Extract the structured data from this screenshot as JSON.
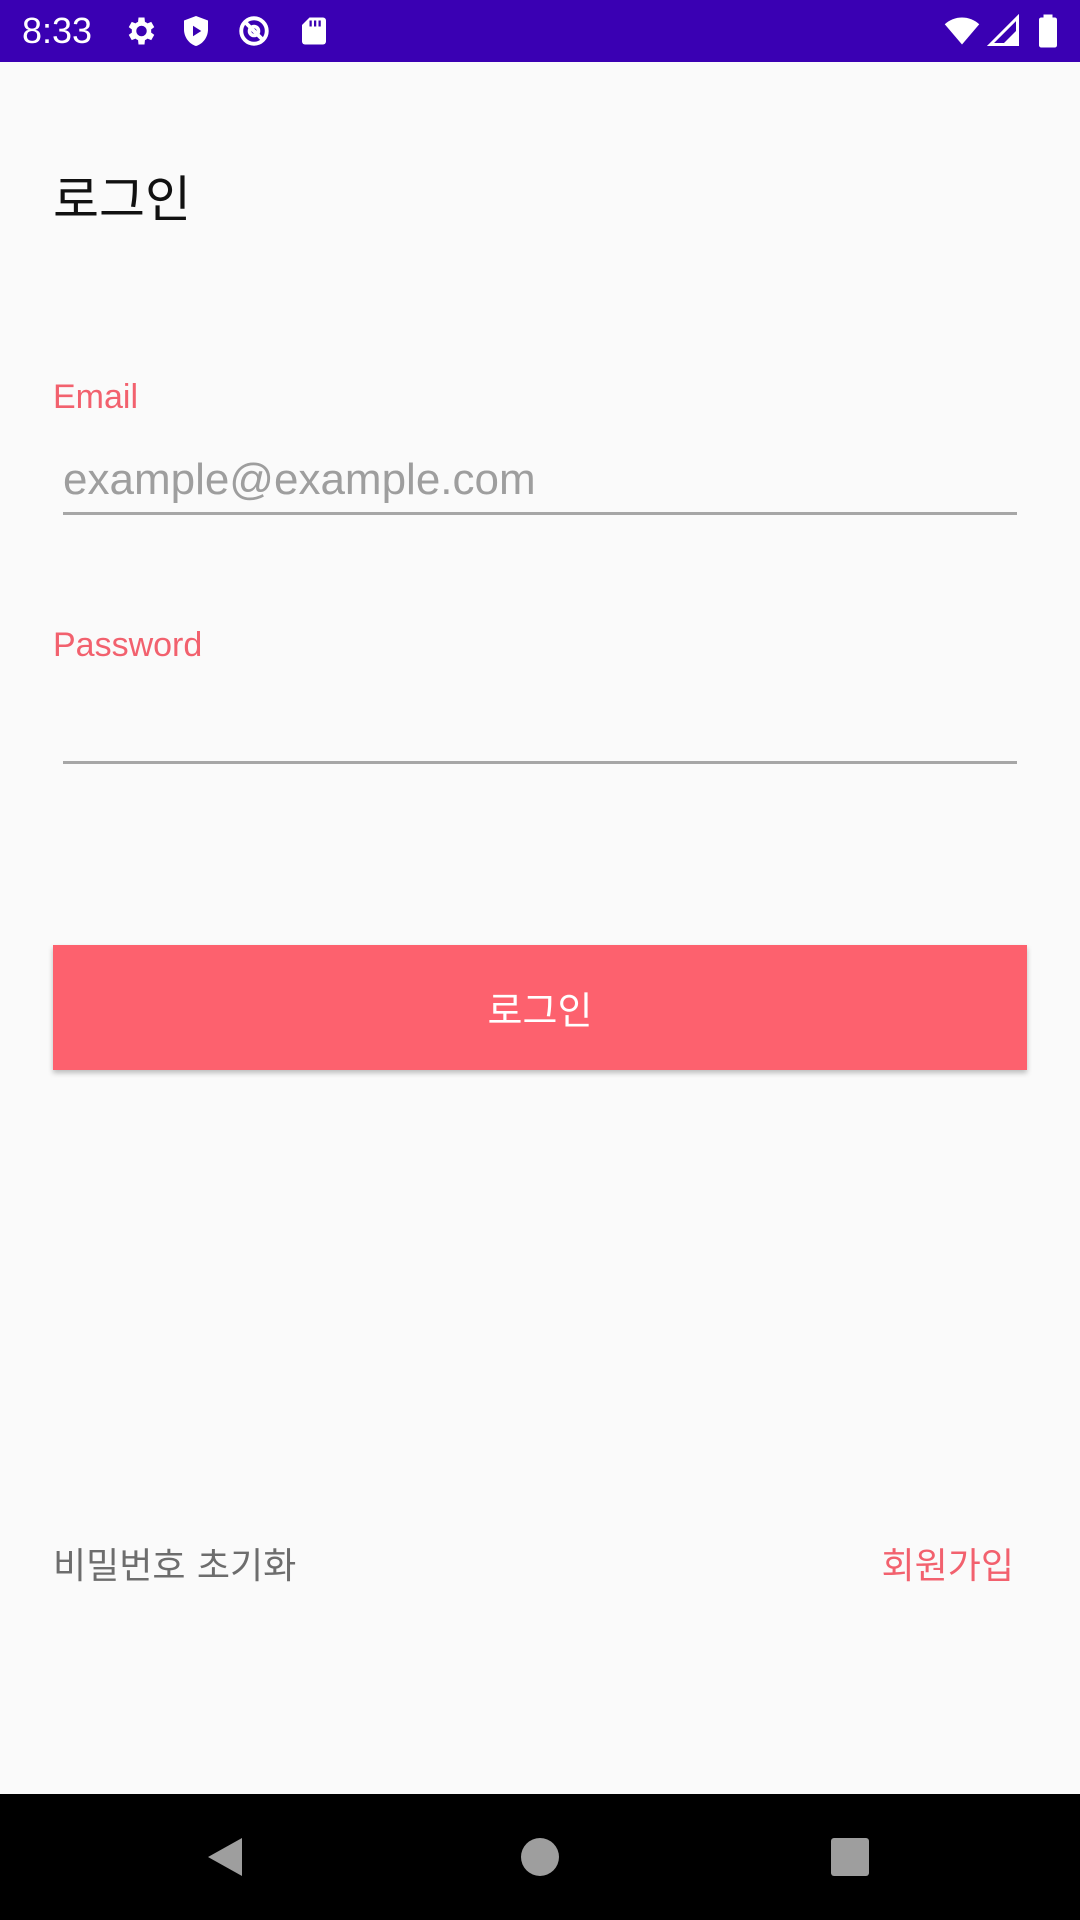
{
  "status_bar": {
    "time": "8:33",
    "icons_left": [
      "gear-icon",
      "shield-play-icon",
      "no-sync-icon",
      "sd-card-icon"
    ],
    "icons_right": [
      "wifi-icon",
      "cell-signal-icon",
      "battery-icon"
    ],
    "background_color": "#3a00b3"
  },
  "screen": {
    "title": "로그인",
    "email": {
      "label": "Email",
      "value": "",
      "placeholder": "example@example.com"
    },
    "password": {
      "label": "Password",
      "value": "",
      "placeholder": ""
    },
    "login_button_label": "로그인",
    "reset_password_label": "비밀번호 초기화",
    "signup_label": "회원가입",
    "accent_color": "#fd616e"
  },
  "nav_bar": {
    "icons": [
      "back-icon",
      "home-icon",
      "recents-icon"
    ]
  }
}
